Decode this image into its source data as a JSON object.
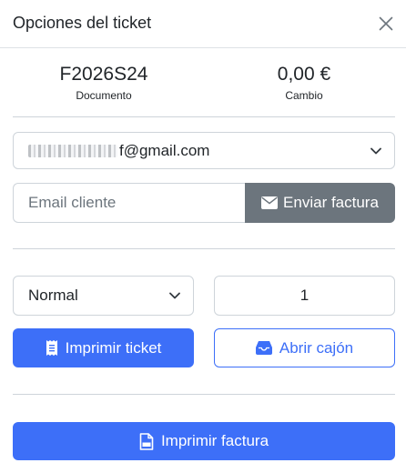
{
  "modal": {
    "title": "Opciones del ticket"
  },
  "summary": {
    "document_value": "F2026S24",
    "document_label": "Documento",
    "change_value": "0,00 €",
    "change_label": "Cambio"
  },
  "email_select": {
    "selected_suffix": "f@gmail.com"
  },
  "email_input": {
    "value": "",
    "placeholder": "Email cliente"
  },
  "buttons": {
    "send_invoice": "Enviar factura",
    "print_ticket": "Imprimir ticket",
    "open_drawer": "Abrir cajón",
    "print_invoice": "Imprimir factura"
  },
  "print_format": {
    "selected": "Normal"
  },
  "copies": {
    "value": "1"
  },
  "colors": {
    "primary": "#3d6ff8",
    "secondary": "#6c757d",
    "border": "#ced4da"
  },
  "icons": {
    "close": "close-icon",
    "chevron": "chevron-down-icon",
    "envelope": "envelope-icon",
    "receipt": "receipt-icon",
    "drawer": "inbox-icon",
    "pdf": "file-pdf-icon"
  }
}
